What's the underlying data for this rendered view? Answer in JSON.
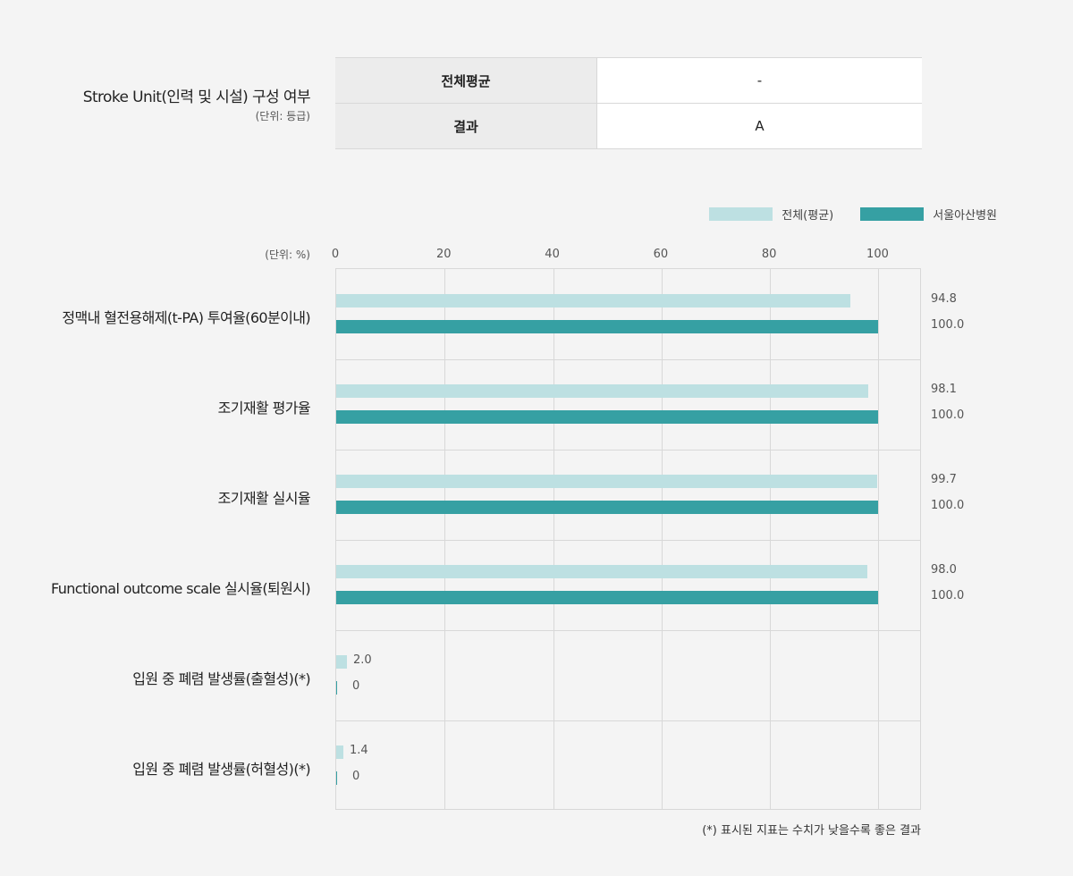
{
  "stroke_unit": {
    "title": "Stroke Unit(인력 및 시설) 구성 여부",
    "unit": "(단위: 등급)",
    "rows": [
      {
        "label": "전체평균",
        "value": "-"
      },
      {
        "label": "결과",
        "value": "A"
      }
    ]
  },
  "colors": {
    "avg": "#bde0e2",
    "hospital": "#36a0a3"
  },
  "chart_data": {
    "type": "bar",
    "orientation": "horizontal",
    "unit_label": "(단위: %)",
    "xticks": [
      "0",
      "20",
      "40",
      "60",
      "80",
      "100"
    ],
    "xlim": [
      0,
      108
    ],
    "grid": true,
    "legend_position": "top-right",
    "categories": [
      "정맥내 혈전용해제(t-PA) 투여율(60분이내)",
      "조기재활 평가율",
      "조기재활 실시율",
      "Functional outcome scale 실시율(퇴원시)",
      "입원 중 폐렴 발생률(출혈성)(*)",
      "입원 중 폐렴 발생률(허혈성)(*)"
    ],
    "series": [
      {
        "name": "전체(평균)",
        "values": [
          94.8,
          98.1,
          99.7,
          98.0,
          2.0,
          1.4
        ],
        "labels": [
          "94.8",
          "98.1",
          "99.7",
          "98.0",
          "2.0",
          "1.4"
        ]
      },
      {
        "name": "서울아산병원",
        "values": [
          100.0,
          100.0,
          100.0,
          100.0,
          0,
          0
        ],
        "labels": [
          "100.0",
          "100.0",
          "100.0",
          "100.0",
          "0",
          "0"
        ]
      }
    ],
    "footnote": "(*) 표시된 지표는 수치가 낮을수록 좋은 결과"
  }
}
